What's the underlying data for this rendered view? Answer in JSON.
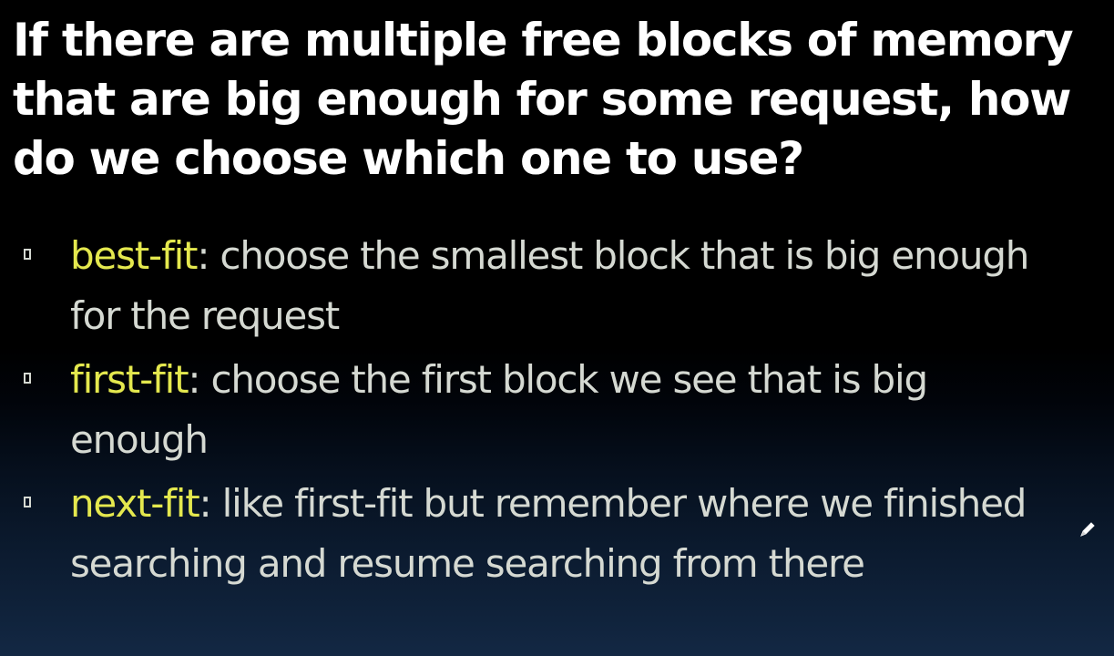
{
  "slide": {
    "title": "If there are multiple free blocks of memory that are big enough for some request, how do we choose which one to use?",
    "bullets": [
      {
        "term": "best-fit",
        "separator": ":",
        "text": " choose the smallest block that is big enough for the request"
      },
      {
        "term": "first-fit",
        "separator": ":",
        "text": " choose the first block we see that is big enough"
      },
      {
        "term": "next-fit",
        "separator": ":",
        "text": " like first-fit but remember where we finished searching and resume searching from there"
      }
    ],
    "cursor_icon": "pencil-icon"
  },
  "colors": {
    "title": "#ffffff",
    "term": "#e4e84e",
    "body_text": "#d5d9d2",
    "background_top": "#000000",
    "background_bottom": "#132844"
  }
}
